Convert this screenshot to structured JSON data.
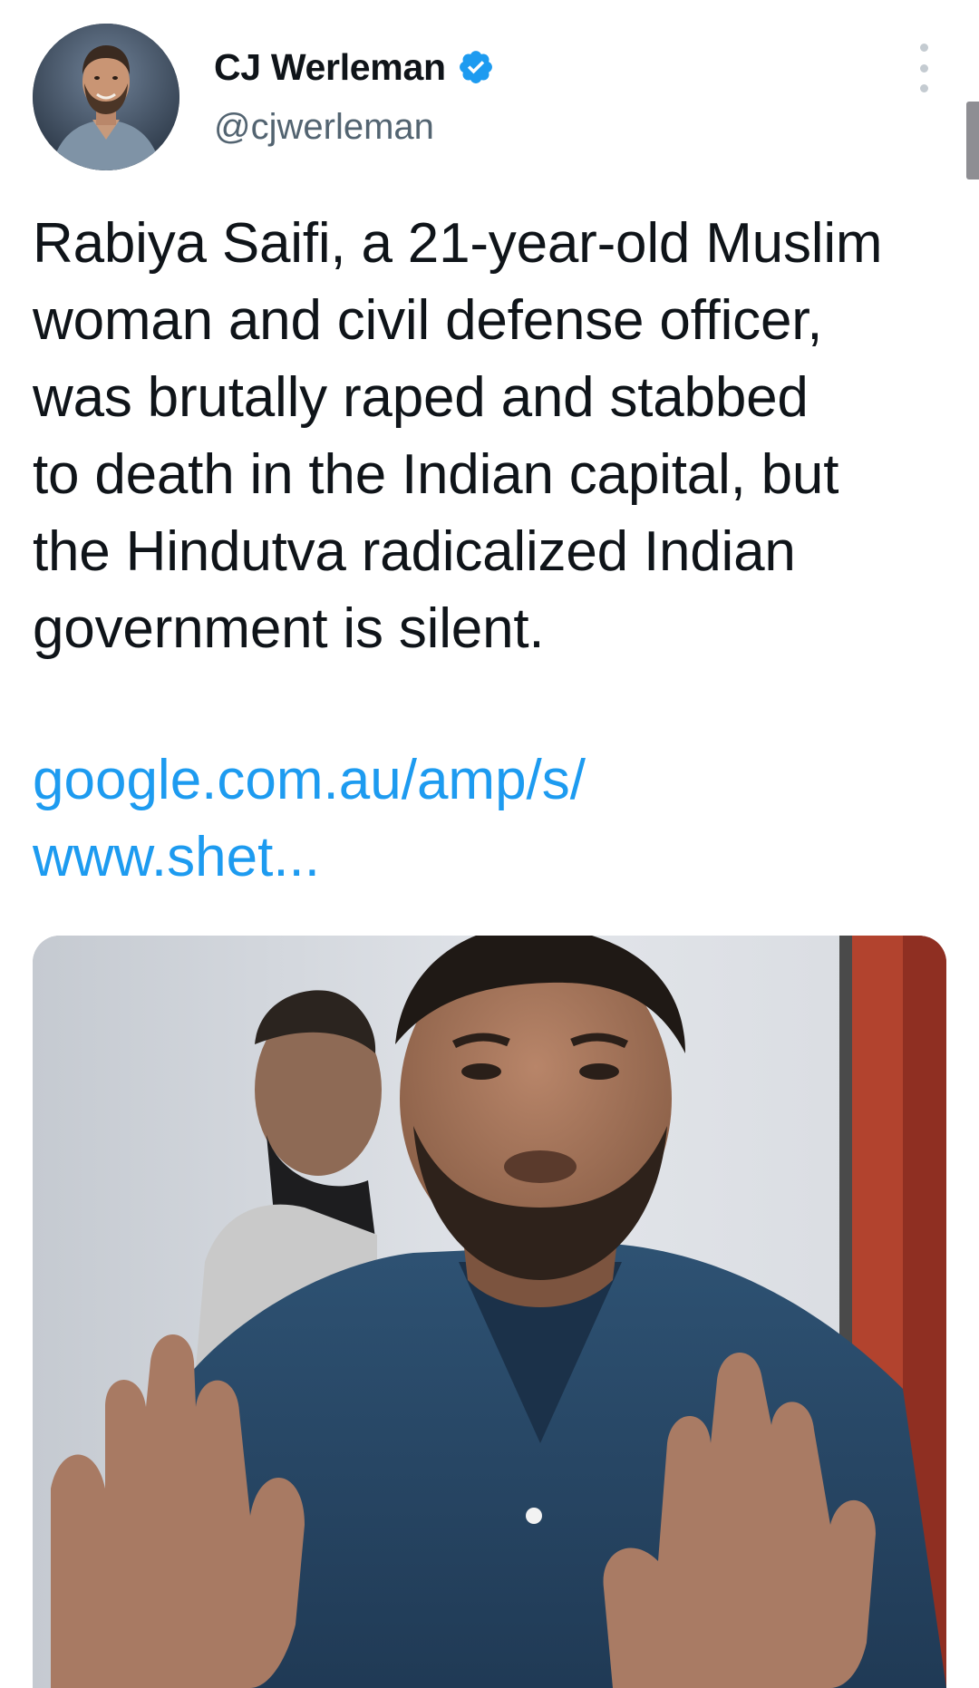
{
  "author": {
    "display_name": "CJ Werleman",
    "handle": "@cjwerleman",
    "verified": true,
    "avatar_icon": "profile-photo"
  },
  "tweet": {
    "text_lines": [
      "Rabiya Saifi, a 21-year-old Muslim",
      "woman and civil defense officer,",
      "was brutally raped and stabbed",
      "to death in the Indian capital, but",
      "the Hindutva radicalized Indian",
      "government is silent."
    ],
    "link_lines": [
      "google.com.au/amp/s/",
      "www.shet..."
    ]
  },
  "icons": {
    "more": "more-vertical-icon",
    "verified": "verified-badge-icon"
  },
  "colors": {
    "link": "#1d9bf0",
    "verified": "#1d9bf0",
    "secondary_text": "#536471",
    "text": "#0f1419"
  }
}
